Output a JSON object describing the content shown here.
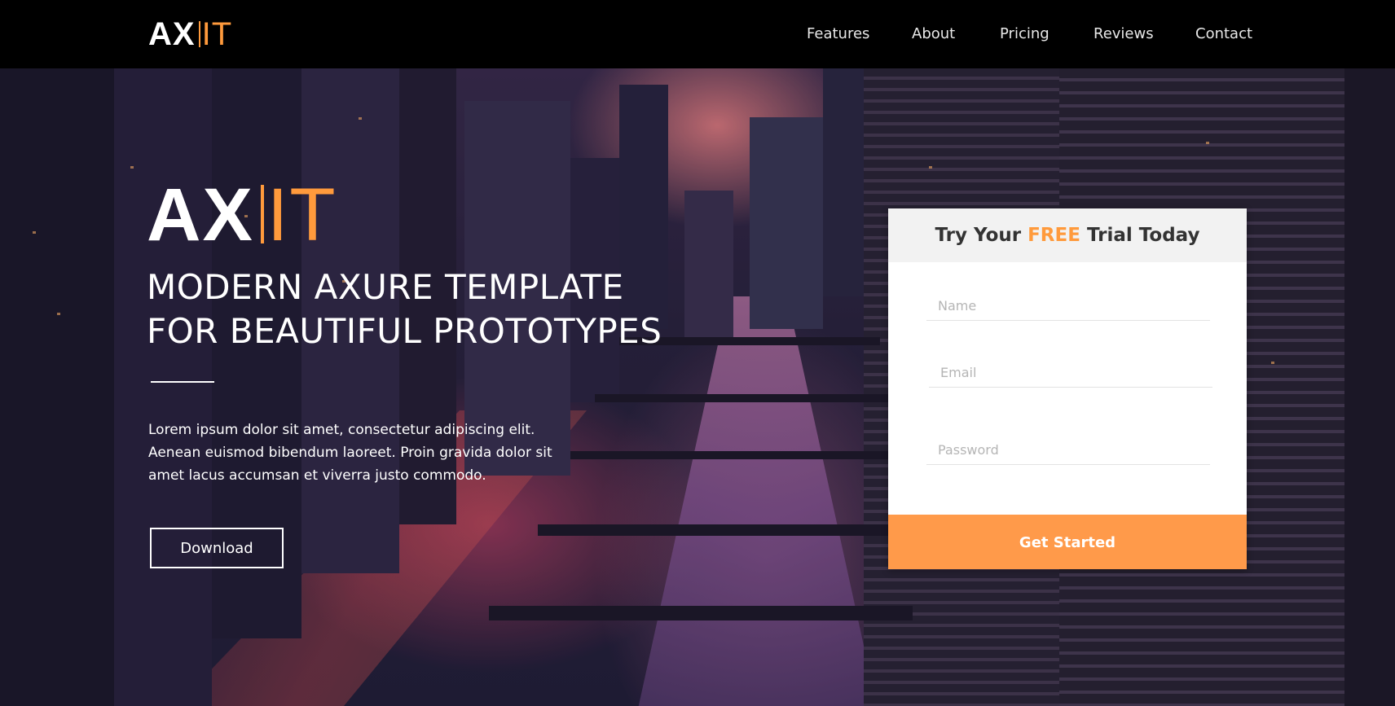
{
  "header": {
    "logo_main": "AX",
    "logo_accent": "IT",
    "nav": [
      "Features",
      "About",
      "Pricing",
      "Reviews",
      "Contact"
    ]
  },
  "hero": {
    "logo_main": "AX",
    "logo_accent": "IT",
    "headline_line1": "MODERN AXURE TEMPLATE",
    "headline_line2": "FOR BEAUTIFUL PROTOTYPES",
    "body": "Lorem ipsum dolor sit amet, consectetur adipiscing elit. Aenean euismod bibendum laoreet. Proin gravida dolor sit amet lacus accumsan et viverra justo commodo.",
    "download_label": "Download"
  },
  "signup": {
    "title_before": "Try Your ",
    "title_highlight": "FREE",
    "title_after": " Trial Today",
    "name_placeholder": "Name",
    "email_placeholder": "Email",
    "password_placeholder": "Password",
    "submit_label": "Get Started"
  },
  "colors": {
    "accent": "#ff9a3c",
    "button": "#ff9a4a",
    "nav_bg": "#000000"
  }
}
